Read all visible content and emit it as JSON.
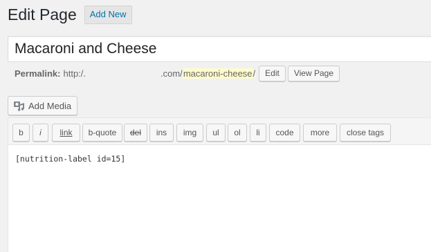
{
  "header": {
    "title": "Edit Page",
    "add_new_label": "Add New"
  },
  "post": {
    "title_value": "Macaroni and Cheese"
  },
  "permalink": {
    "label": "Permalink:",
    "base": "http:/.",
    "domain_suffix": ".com/",
    "slug": "macaroni-cheese",
    "trailing": "/",
    "edit_label": "Edit",
    "view_label": "View Page"
  },
  "media": {
    "add_media_label": "Add Media",
    "icon": "camera-music-icon"
  },
  "toolbar": {
    "buttons": [
      {
        "label": "b"
      },
      {
        "label": "i"
      },
      {
        "label": "link"
      },
      {
        "label": "b-quote"
      },
      {
        "label": "del"
      },
      {
        "label": "ins"
      },
      {
        "label": "img"
      },
      {
        "label": "ul"
      },
      {
        "label": "ol"
      },
      {
        "label": "li"
      },
      {
        "label": "code"
      },
      {
        "label": "more"
      },
      {
        "label": "close tags"
      }
    ]
  },
  "editor": {
    "content": "[nutrition-label id=15]"
  },
  "colors": {
    "background": "#f1f1f1",
    "link_blue": "#0073aa",
    "slug_highlight": "#fffbcc"
  }
}
